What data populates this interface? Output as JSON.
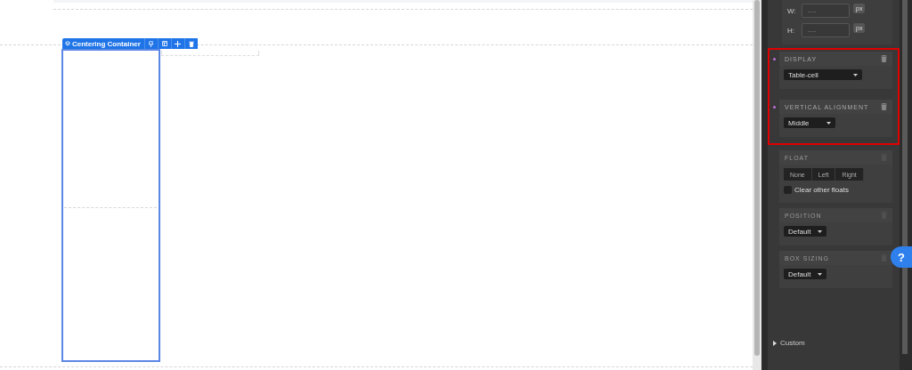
{
  "canvas": {
    "element_toolbar": {
      "label": "Centering Container"
    }
  },
  "panel": {
    "size": {
      "fields": [
        {
          "label": "W:",
          "placeholder": "----",
          "unit": "px"
        },
        {
          "label": "H:",
          "placeholder": "----",
          "unit": "px"
        }
      ]
    },
    "sections": [
      {
        "kind": "select",
        "title": "DISPLAY",
        "value": "Table-cell",
        "modified": true,
        "highlighted": true
      },
      {
        "kind": "select",
        "title": "VERTICAL ALIGNMENT",
        "value": "Middle",
        "modified": true,
        "highlighted": true
      },
      {
        "kind": "float",
        "title": "FLOAT",
        "modified": false,
        "highlighted": false,
        "options": [
          "None",
          "Left",
          "Right"
        ],
        "checkbox": {
          "label": "Clear other floats",
          "checked": false
        }
      },
      {
        "kind": "select",
        "title": "POSITION",
        "value": "Default",
        "modified": false,
        "highlighted": false
      },
      {
        "kind": "select",
        "title": "BOX SIZING",
        "value": "Default",
        "modified": false,
        "highlighted": false
      }
    ],
    "custom": {
      "label": "Custom",
      "expanded": false
    }
  },
  "help": {
    "label": "?"
  }
}
